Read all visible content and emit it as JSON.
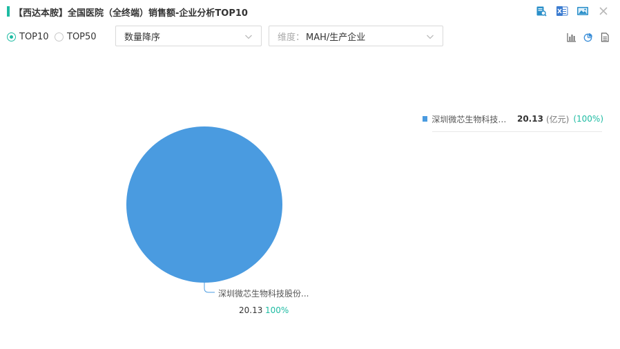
{
  "header": {
    "title": "【西达本胺】全国医院（全终端）销售额-企业分析TOP10",
    "icons": [
      "report-search-icon",
      "excel-export-icon",
      "image-export-icon",
      "close-icon"
    ]
  },
  "toolbar": {
    "radio_top10": "TOP10",
    "radio_top50": "TOP50",
    "selected": "TOP10",
    "sort_select": "数量降序",
    "dimension_prefix": "维度：",
    "dimension_value": "MAH/生产企业",
    "view_icons": [
      "bar-chart-icon",
      "pie-chart-icon",
      "table-icon"
    ]
  },
  "colors": {
    "accent": "#1dbba2",
    "slice1": "#4a9be0"
  },
  "chart_data": {
    "type": "pie",
    "unit": "(亿元)",
    "slices": [
      {
        "name": "深圳微芯生物科技股…",
        "label_name": "深圳微芯生物科技股份...",
        "value": 20.13,
        "value_text": "20.13",
        "percent_text": "100%",
        "percent_paren": "(100%)",
        "color": "#4a9be0"
      }
    ]
  }
}
